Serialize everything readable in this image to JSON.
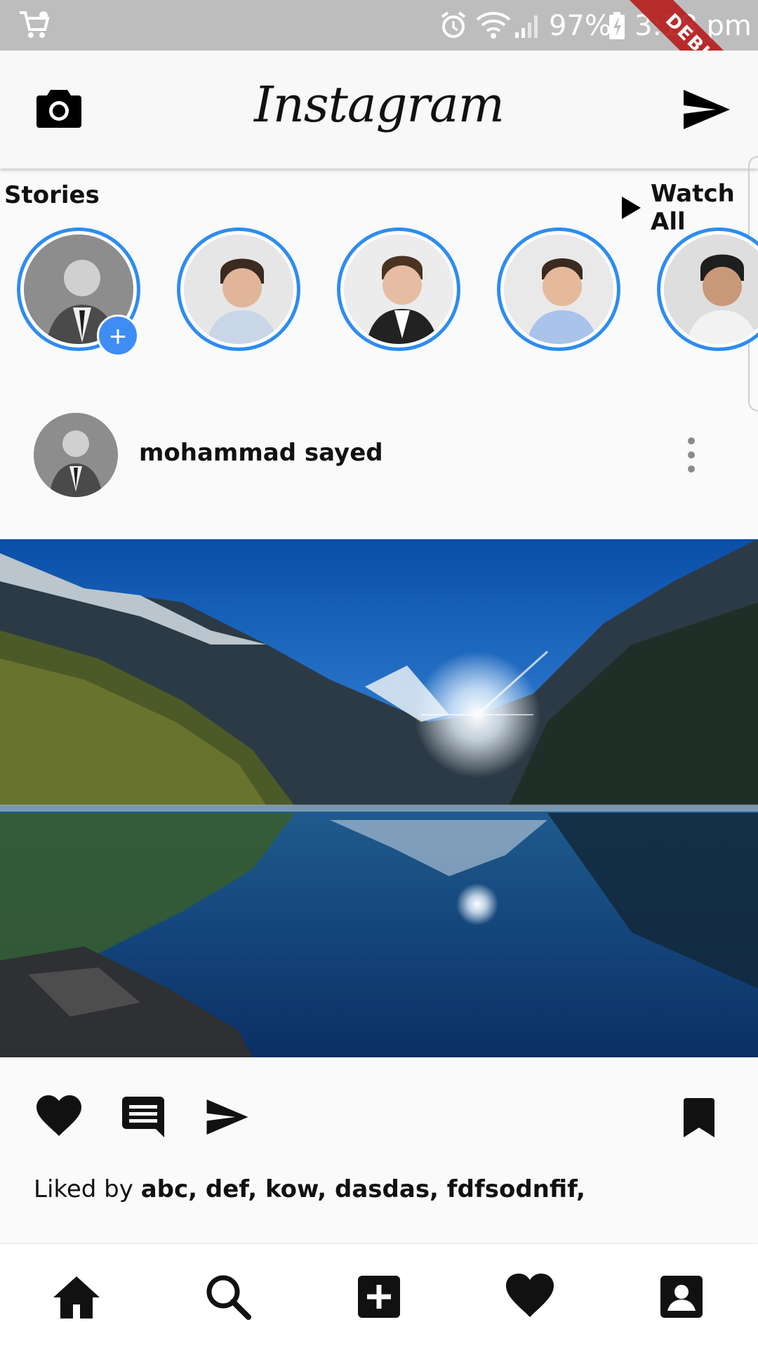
{
  "status_bar": {
    "battery": "97%",
    "time": "3:18 pm",
    "debug_label": "DEBUG",
    "icons": [
      "shopping-cart-icon",
      "alarm-icon",
      "wifi-icon",
      "signal-icon",
      "battery-icon"
    ]
  },
  "app_bar": {
    "title": "Instagram",
    "left_icon": "camera-icon",
    "right_icon": "send-icon"
  },
  "stories": {
    "label": "Stories",
    "watch_all": "Watch All",
    "items": [
      {
        "user": "own-story",
        "has_add_badge": true
      },
      {
        "user": "story-2"
      },
      {
        "user": "story-3"
      },
      {
        "user": "story-4"
      },
      {
        "user": "story-5"
      }
    ],
    "ring_color": "#2d8cf0"
  },
  "post": {
    "username": "mohammad sayed",
    "image_description": "mountain-lake-photo",
    "liked_by_prefix": "Liked by",
    "liked_by_names": "abc, def, kow, dasdas, fdfsodnfif,",
    "actions": [
      "heart-icon",
      "comment-icon",
      "send-icon",
      "bookmark-icon"
    ]
  },
  "bottom_nav": {
    "items": [
      "home-icon",
      "search-icon",
      "add-box-icon",
      "heart-icon",
      "profile-icon"
    ]
  },
  "colors": {
    "status_bar": "#bdbdbd",
    "accent": "#3d8df5",
    "debug": "#b71c1c"
  }
}
